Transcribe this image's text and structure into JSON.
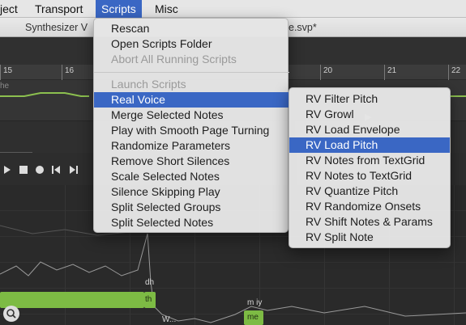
{
  "menubar": {
    "items": [
      "ject",
      "Transport",
      "Scripts",
      "Misc"
    ]
  },
  "window": {
    "title_left": "Synthesizer V",
    "title_right": "e.svp*"
  },
  "ruler": {
    "ticks": [
      "15",
      "16",
      "20",
      "21",
      "22"
    ]
  },
  "track_labels": {
    "top_left": "he"
  },
  "transport": {
    "play_icon": "play-icon",
    "stop_icon": "stop-icon",
    "record_icon": "record-icon",
    "prev_icon": "skip-back-icon",
    "next_icon": "skip-forward-icon"
  },
  "piano": {
    "note1_label": "th",
    "note2_label": "me",
    "lyric1": "dh",
    "lyric2": "m iy",
    "lyric3": "W..."
  },
  "scripts_menu": {
    "items": [
      {
        "label": "Rescan",
        "enabled": true
      },
      {
        "label": "Open Scripts Folder",
        "enabled": true
      },
      {
        "label": "Abort All Running Scripts",
        "enabled": false
      },
      {
        "label": "Launch Scripts",
        "enabled": false
      },
      {
        "label": "Real Voice",
        "enabled": true,
        "submenu": true,
        "highlighted": true
      },
      {
        "label": "Merge Selected Notes",
        "enabled": true
      },
      {
        "label": "Play with Smooth Page Turning",
        "enabled": true
      },
      {
        "label": "Randomize Parameters",
        "enabled": true
      },
      {
        "label": "Remove Short Silences",
        "enabled": true
      },
      {
        "label": "Scale Selected Notes",
        "enabled": true
      },
      {
        "label": "Silence Skipping Play",
        "enabled": true
      },
      {
        "label": "Split Selected Groups",
        "enabled": true
      },
      {
        "label": "Split Selected Notes",
        "enabled": true
      }
    ]
  },
  "real_voice_submenu": {
    "items": [
      {
        "label": "RV Filter Pitch"
      },
      {
        "label": "RV Growl"
      },
      {
        "label": "RV Load Envelope"
      },
      {
        "label": "RV Load Pitch",
        "highlighted": true
      },
      {
        "label": "RV Notes from TextGrid"
      },
      {
        "label": "RV Notes to TextGrid"
      },
      {
        "label": "RV Quantize Pitch"
      },
      {
        "label": "RV Randomize Onsets"
      },
      {
        "label": "RV Shift Notes & Params"
      },
      {
        "label": "RV Split Note"
      }
    ]
  },
  "colors": {
    "menu_highlight": "#3a67c4",
    "note_green": "#7dbb44",
    "menu_bg": "#e4e4e4"
  }
}
